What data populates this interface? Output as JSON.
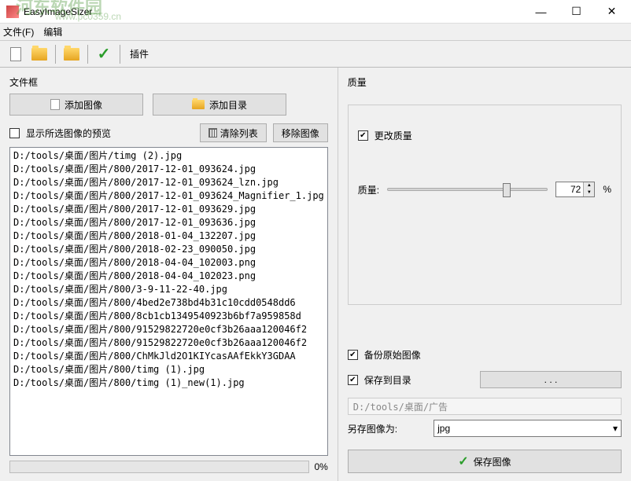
{
  "window": {
    "title": "EasyImageSizer",
    "min": "—",
    "max": "☐",
    "close": "✕"
  },
  "menu": {
    "file": "文件(F)",
    "edit": "编辑",
    "plugin": "插件"
  },
  "watermark": {
    "line1": "河东软件园",
    "line2": "www.pc0359.cn"
  },
  "left": {
    "group_title": "文件框",
    "add_image": "添加图像",
    "add_dir": "添加目录",
    "show_preview": "显示所选图像的预览",
    "clear_list": "清除列表",
    "remove_image": "移除图像",
    "progress_pct": "0%",
    "files": [
      "D:/tools/桌面/图片/timg (2).jpg",
      "D:/tools/桌面/图片/800/2017-12-01_093624.jpg",
      "D:/tools/桌面/图片/800/2017-12-01_093624_lzn.jpg",
      "D:/tools/桌面/图片/800/2017-12-01_093624_Magnifier_1.jpg",
      "D:/tools/桌面/图片/800/2017-12-01_093629.jpg",
      "D:/tools/桌面/图片/800/2017-12-01_093636.jpg",
      "D:/tools/桌面/图片/800/2018-01-04_132207.jpg",
      "D:/tools/桌面/图片/800/2018-02-23_090050.jpg",
      "D:/tools/桌面/图片/800/2018-04-04_102003.png",
      "D:/tools/桌面/图片/800/2018-04-04_102023.png",
      "D:/tools/桌面/图片/800/3-9-11-22-40.jpg",
      "D:/tools/桌面/图片/800/4bed2e738bd4b31c10cdd0548dd6",
      "D:/tools/桌面/图片/800/8cb1cb1349540923b6bf7a959858d",
      "D:/tools/桌面/图片/800/91529822720e0cf3b26aaa120046f2",
      "D:/tools/桌面/图片/800/91529822720e0cf3b26aaa120046f2",
      "D:/tools/桌面/图片/800/ChMkJld2O1KIYcasAAfEkkY3GDAA",
      "D:/tools/桌面/图片/800/timg (1).jpg",
      "D:/tools/桌面/图片/800/timg (1)_new(1).jpg"
    ]
  },
  "right": {
    "group_title": "质量",
    "change_quality": "更改质量",
    "quality_label": "质量:",
    "quality_value": "72",
    "pct": "%",
    "backup_original": "备份原始图像",
    "save_to_dir": "保存到目录",
    "dir_btn": ". . .",
    "save_path": "D:/tools/桌面/广告",
    "save_as_label": "另存图像为:",
    "format": "jpg",
    "save_image": "保存图像"
  }
}
